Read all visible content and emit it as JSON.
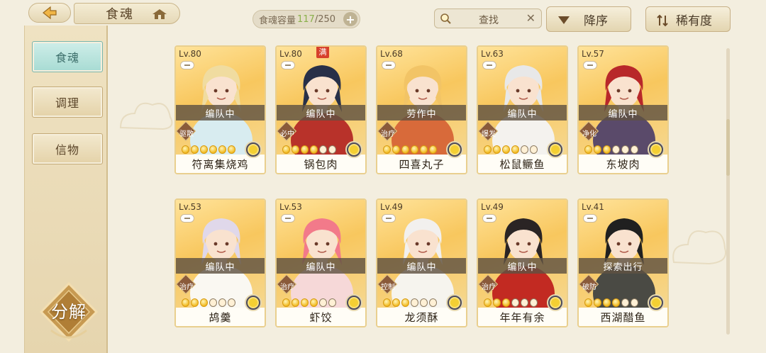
{
  "header": {
    "title": "食魂",
    "capacity_label": "食魂容量",
    "capacity_current": "117",
    "capacity_max": "/250",
    "search_label": "查找",
    "sort_order_label": "降序",
    "sort_field_label": "稀有度"
  },
  "sidebar": {
    "items": [
      {
        "label": "食魂",
        "active": true
      },
      {
        "label": "调理",
        "active": false
      },
      {
        "label": "信物",
        "active": false
      }
    ],
    "decompose_label": "分解"
  },
  "cards": [
    {
      "level": "Lv.80",
      "status": "编队中",
      "role": "驱散",
      "name": "符离集烧鸡",
      "stars": 6,
      "stars_total": 6,
      "hair": "#f0dca0",
      "outfit": "#d8ecf0",
      "rarity_icon": "moon-icon"
    },
    {
      "level": "Lv.80",
      "status": "编队中",
      "role": "必中",
      "name": "锅包肉",
      "stars": 4,
      "stars_total": 6,
      "hair": "#283048",
      "outfit": "#b8322a",
      "badge": "满",
      "rarity_icon": "flower-icon"
    },
    {
      "level": "Lv.68",
      "status": "劳作中",
      "role": "治疗",
      "name": "四喜丸子",
      "stars": 6,
      "stars_total": 6,
      "hair": "#f2c466",
      "outfit": "#d86a3a",
      "rarity_icon": "flower-icon"
    },
    {
      "level": "Lv.63",
      "status": "编队中",
      "role": "爆发",
      "name": "松鼠鳜鱼",
      "stars": 4,
      "stars_total": 6,
      "hair": "#e8e8e8",
      "outfit": "#f4f2ee",
      "rarity_icon": "flower-icon"
    },
    {
      "level": "Lv.57",
      "status": "编队中",
      "role": "净化",
      "name": "东坡肉",
      "stars": 3,
      "stars_total": 6,
      "hair": "#b8282a",
      "outfit": "#5a4a6a",
      "rarity_icon": "flower-icon"
    },
    {
      "level": "Lv.53",
      "status": "编队中",
      "role": "治疗",
      "name": "鸪羹",
      "stars": 3,
      "stars_total": 6,
      "hair": "#e0d8ea",
      "outfit": "#faf8f2",
      "rarity_icon": "flower-icon"
    },
    {
      "level": "Lv.53",
      "status": "编队中",
      "role": "治疗",
      "name": "虾饺",
      "stars": 4,
      "stars_total": 6,
      "hair": "#f27a8a",
      "outfit": "#f6d8d8",
      "rarity_icon": "flower-icon"
    },
    {
      "level": "Lv.49",
      "status": "编队中",
      "role": "控制",
      "name": "龙须酥",
      "stars": 3,
      "stars_total": 6,
      "hair": "#f2f0ee",
      "outfit": "#f6f4ee",
      "rarity_icon": "flower-icon"
    },
    {
      "level": "Lv.49",
      "status": "编队中",
      "role": "治疗",
      "name": "年年有余",
      "stars": 3,
      "stars_total": 6,
      "hair": "#2a2424",
      "outfit": "#c22a22",
      "rarity_icon": "flower-icon"
    },
    {
      "level": "Lv.41",
      "status": "探索出行",
      "role": "破防",
      "name": "西湖醋鱼",
      "stars": 4,
      "stars_total": 6,
      "hair": "#202020",
      "outfit": "#4a4a44",
      "rarity_icon": "flower-icon"
    }
  ],
  "colors": {
    "background": "#f3eedf",
    "accent_gold": "#e9cf8e",
    "active_tab": "#a7dbd3",
    "status_bar": "#5f5242",
    "capacity_current": "#8ab04a"
  }
}
